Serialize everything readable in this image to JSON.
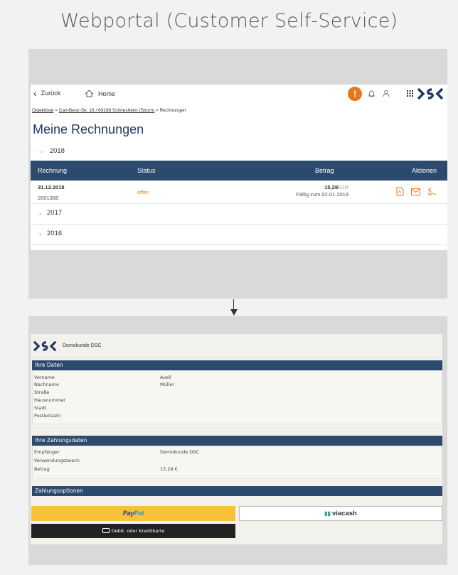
{
  "page": {
    "title": "Webportal (Customer Self-Service)"
  },
  "portal": {
    "nav": {
      "back": "Zurück",
      "home": "Home",
      "alert": "!"
    },
    "breadcrumb": {
      "link1": "Objektliste",
      "sep1": " > ",
      "link2": "Carl-Benz-Str. 16 / 69198 Schriesheim (Strom)",
      "rest": " > Rechnungen"
    },
    "heading": "Meine Rechnungen",
    "years": [
      "2018",
      "2017",
      "2016"
    ],
    "table": {
      "headers": {
        "rechnung": "Rechnung",
        "status": "Status",
        "betrag": "Betrag",
        "aktionen": "Aktionen"
      },
      "row": {
        "date": "31.12.2018",
        "number": "2001368",
        "status": "offen",
        "amount": "15,28",
        "currency": "EUR",
        "due": "Fällig zum 02.01.2019"
      }
    }
  },
  "payment": {
    "customer": "Demokunde DSC",
    "sections": {
      "ihre_daten": "Ihre Daten",
      "zahlungsdaten": "Ihre Zahlungsdaten",
      "optionen": "Zahlungsoptionen"
    },
    "fields": {
      "vorname_label": "Vorname",
      "vorname_value": "Axell",
      "nachname_label": "Nachname",
      "nachname_value": "Müller",
      "strasse_label": "Straße",
      "hausnummer_label": "Hausnummer",
      "stadt_label": "Stadt",
      "plz_label": "Postleitzahl",
      "empfaenger_label": "Empfänger",
      "empfaenger_value": "Demokunde DSC",
      "zweck_label": "Verwendungszweck",
      "betrag_label": "Betrag",
      "betrag_value": "15.28 €"
    },
    "buttons": {
      "paypal_pay": "Pay",
      "paypal_pal": "Pal",
      "viacash": "viacash",
      "card": "Debit- oder Kreditkarte"
    }
  },
  "colors": {
    "accent": "#e8761c",
    "navy": "#2c4a6e",
    "heading": "#1f3864"
  },
  "icons": [
    "chevron-left-icon",
    "home-icon",
    "alert-icon",
    "bell-icon",
    "user-icon",
    "apps-grid-icon",
    "pdf-icon",
    "mail-icon",
    "pay-icon",
    "card-icon"
  ]
}
